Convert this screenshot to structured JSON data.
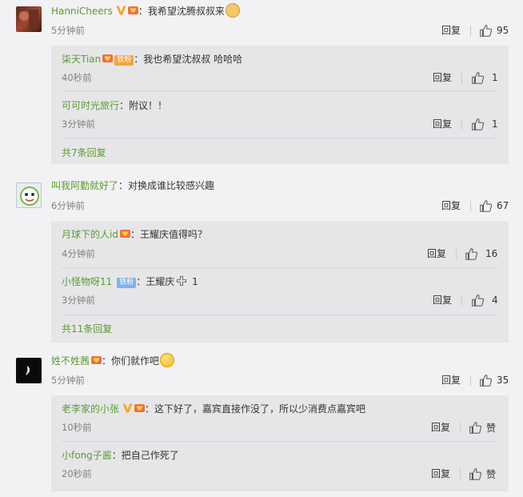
{
  "comments": [
    {
      "user": "HanniCheers",
      "text": "：我希望沈腾叔叔来",
      "time": "5分钟前",
      "reply_label": "回复",
      "likes": "95",
      "replies": [
        {
          "user": "柒天Tian",
          "badge": "铁粉",
          "text": "：我也希望沈叔叔 哈哈哈",
          "time": "40秒前",
          "reply_label": "回复",
          "likes": "1"
        },
        {
          "user": "可可时光旅行",
          "text": "：附议！！",
          "time": "3分钟前",
          "reply_label": "回复",
          "likes": "1"
        }
      ],
      "more": "共7条回复"
    },
    {
      "user": "叫我阿勤就好了",
      "text": "：对换成谁比较感兴趣",
      "time": "6分钟前",
      "reply_label": "回复",
      "likes": "67",
      "replies": [
        {
          "user": "月球下的人id",
          "text": "：王耀庆值得吗？",
          "time": "4分钟前",
          "reply_label": "回复",
          "likes": "16"
        },
        {
          "user": "小怪物呀11",
          "badge": "铁粉",
          "text_a": "：王耀庆",
          "text_b": " 1",
          "time": "3分钟前",
          "reply_label": "回复",
          "likes": "4"
        }
      ],
      "more": "共11条回复"
    },
    {
      "user": "姓不姓茜",
      "text": "：你们就作吧",
      "time": "5分钟前",
      "reply_label": "回复",
      "likes": "35",
      "replies": [
        {
          "user": "老李家的小张",
          "text": "：这下好了，嘉宾直接作没了，所以少消费点嘉宾吧",
          "time": "10秒前",
          "reply_label": "回复",
          "likes": "赞"
        },
        {
          "user": "小fong子酱",
          "text": "：把自己作死了",
          "time": "20秒前",
          "reply_label": "回复",
          "likes": "赞"
        }
      ]
    }
  ],
  "colors": {
    "background": "#f2f2f5",
    "reply_box": "#e6e6e9",
    "username": "#5c9b2e",
    "time": "#808080",
    "vip_badge": "#f5a623",
    "tiefen_orange": "#f7a43a",
    "tiefen_blue": "#7fb2e5"
  },
  "icons": [
    "thumb-up-icon",
    "verified-v-icon",
    "fan-badge-icon",
    "plus-icon",
    "emoji-icon"
  ]
}
